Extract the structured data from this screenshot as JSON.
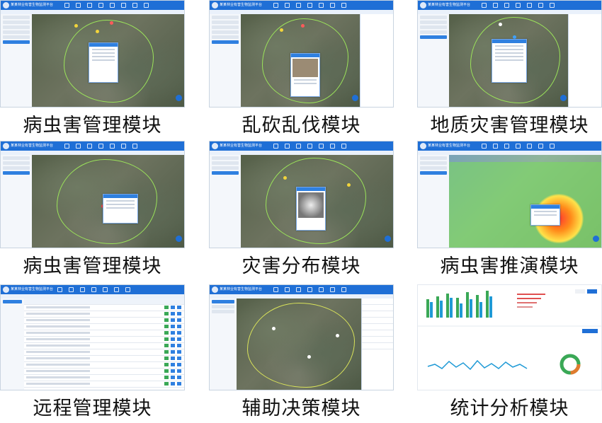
{
  "app": {
    "title": "某某林业有害生物监测平台"
  },
  "colors": {
    "topbar": "#1f6fd6",
    "boundary": "#9be35a",
    "map_terrain": "#5e6b57"
  },
  "modules": [
    {
      "caption": "病虫害管理模块"
    },
    {
      "caption": "乱砍乱伐模块"
    },
    {
      "caption": "地质灾害管理模块"
    },
    {
      "caption": "病虫害管理模块"
    },
    {
      "caption": "灾害分布模块"
    },
    {
      "caption": "病虫害推演模块"
    },
    {
      "caption": "远程管理模块"
    },
    {
      "caption": "辅助决策模块"
    },
    {
      "caption": "统计分析模块"
    }
  ]
}
